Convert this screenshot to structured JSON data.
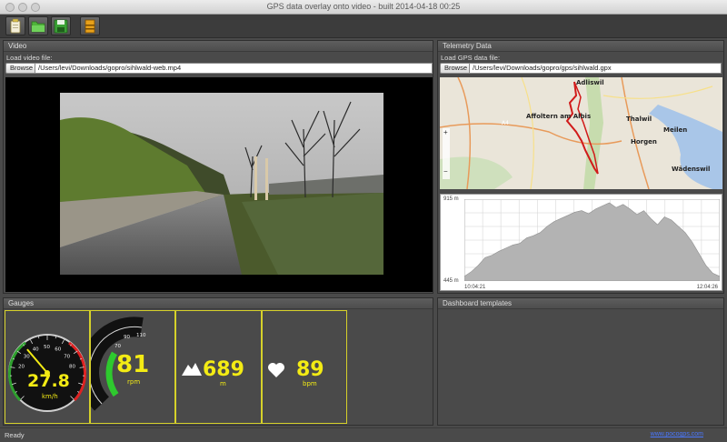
{
  "window": {
    "title": "GPS data overlay onto video - built 2014-04-18 00:25"
  },
  "toolbar": {
    "buttons": [
      "new-icon",
      "open-folder-icon",
      "save-icon",
      "export-icon"
    ]
  },
  "video": {
    "panel_title": "Video",
    "load_label": "Load video file:",
    "browse_label": "Browse",
    "file_path": "/Users/levi/Downloads/gopro/sihlwald-web.mp4"
  },
  "telemetry": {
    "panel_title": "Telemetry Data",
    "load_label": "Load GPS data file:",
    "browse_label": "Browse",
    "file_path": "/Users/levi/Downloads/gopro/gps/sihlwald.gpx",
    "map_labels": {
      "adliswil": "Adliswil",
      "affoltern": "Affoltern am Albis",
      "thalwil": "Thalwil",
      "horgen": "Horgen",
      "meilen": "Meilen",
      "wadenswil": "Wädenswil",
      "a4": "A4"
    },
    "elevation": {
      "max_label": "915 m",
      "min_label": "445 m",
      "start_time": "10:04:21",
      "end_time": "12:04:26",
      "profile": [
        0.06,
        0.12,
        0.2,
        0.3,
        0.33,
        0.38,
        0.42,
        0.46,
        0.48,
        0.55,
        0.58,
        0.62,
        0.7,
        0.76,
        0.8,
        0.84,
        0.88,
        0.9,
        0.86,
        0.92,
        0.96,
        1.0,
        0.94,
        0.98,
        0.92,
        0.85,
        0.9,
        0.8,
        0.72,
        0.82,
        0.78,
        0.7,
        0.62,
        0.5,
        0.35,
        0.2,
        0.1,
        0.06
      ]
    }
  },
  "gauges": {
    "panel_title": "Gauges",
    "speed": {
      "value": "27.8",
      "unit": "km/h",
      "ticks": [
        "20",
        "30",
        "40",
        "50",
        "60",
        "70",
        "80"
      ],
      "fraction": 0.35
    },
    "cadence": {
      "value": "81",
      "unit": "rpm",
      "ticks": [
        "70",
        "90",
        "110"
      ],
      "fraction": 0.55
    },
    "altitude": {
      "value": "689",
      "unit": "m"
    },
    "heart_rate": {
      "value": "89",
      "unit": "bpm"
    }
  },
  "dashboard_templates": {
    "panel_title": "Dashboard templates"
  },
  "status": {
    "text": "Ready",
    "link": "www.pocogps.com"
  }
}
